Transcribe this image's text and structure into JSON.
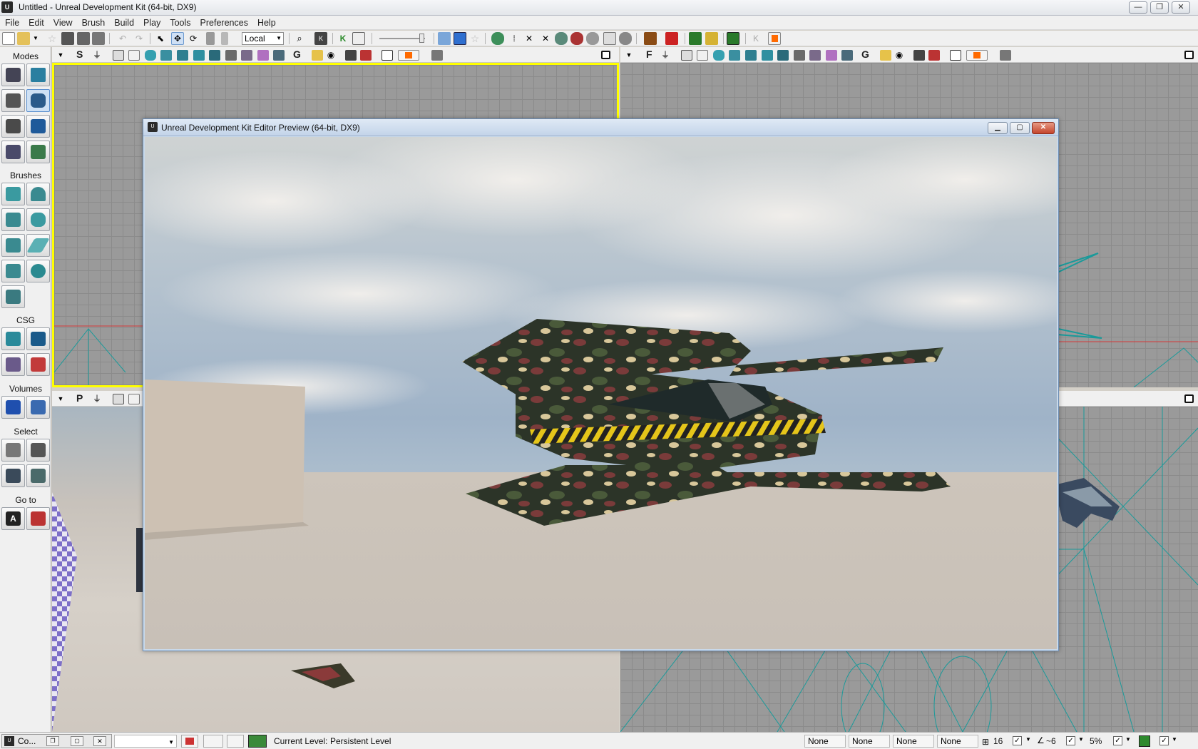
{
  "window": {
    "title": "Untitled - Unreal Development Kit (64-bit, DX9)",
    "minimize": "—",
    "maximize": "❐",
    "close": "✕"
  },
  "menu": [
    "File",
    "Edit",
    "View",
    "Brush",
    "Build",
    "Play",
    "Tools",
    "Preferences",
    "Help"
  ],
  "toolbar": {
    "coordinate_system": "Local"
  },
  "modes_panel": {
    "sections": [
      "Modes",
      "Brushes",
      "CSG",
      "Volumes",
      "Select",
      "Go to"
    ]
  },
  "viewports": {
    "top_left_letter": "S",
    "top_right_letter": "F",
    "bottom_left_letter": "P",
    "active_border_color": "#ffff00",
    "grid_color": "#9a9a9a",
    "wireframe_color": "#1a9a9a"
  },
  "preview": {
    "title": "Unreal Development Kit Editor Preview (64-bit, DX9)",
    "minimize": "▁",
    "maximize": "▢",
    "close": "✕"
  },
  "statusbar": {
    "console_label": "Co...",
    "current_level_label": "Current Level:",
    "current_level_value": "Persistent Level",
    "fields": [
      "None",
      "None",
      "None",
      "None"
    ],
    "grid_size": "16",
    "rotation_snap": "~6",
    "scale_snap": "5%"
  }
}
